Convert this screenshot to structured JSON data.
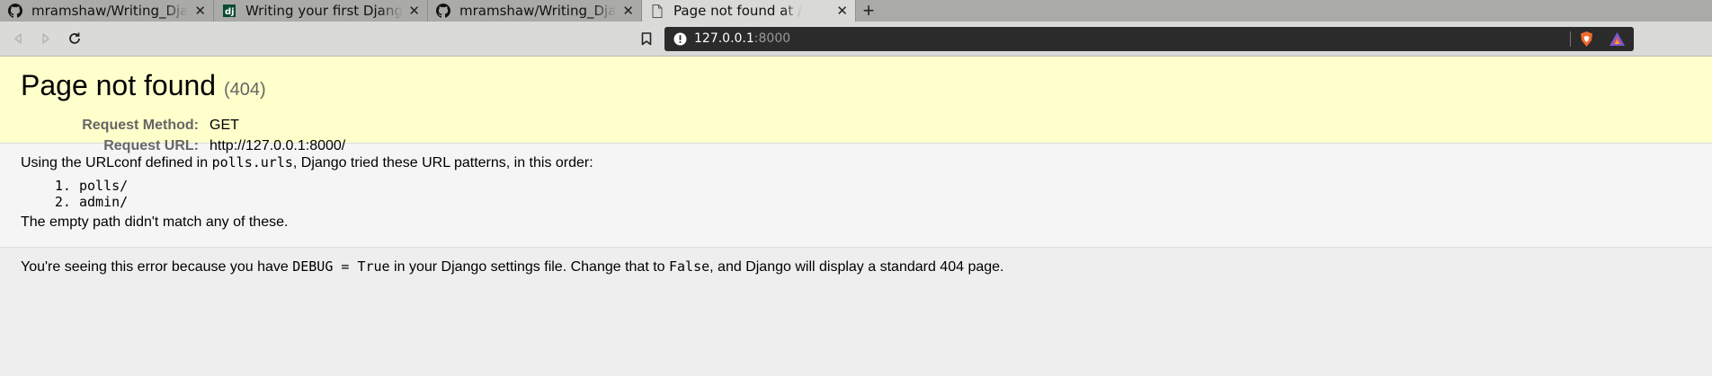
{
  "browser": {
    "tabs": [
      {
        "title": "mramshaw/Writing_Dja",
        "favicon": "github-icon",
        "active": false
      },
      {
        "title": "Writing your first Djang",
        "favicon": "django-icon",
        "active": false
      },
      {
        "title": "mramshaw/Writing_Dja",
        "favicon": "github-icon",
        "active": false
      },
      {
        "title": "Page not found at /",
        "favicon": "document-icon",
        "active": true
      }
    ],
    "close_glyph": "✕",
    "new_tab_glyph": "+",
    "url_host": "127.0.0.1",
    "url_port": ":8000"
  },
  "page": {
    "title": "Page not found",
    "status_code": "(404)",
    "request_method_label": "Request Method:",
    "request_method_value": "GET",
    "request_url_label": "Request URL:",
    "request_url_value": "http://127.0.0.1:8000/",
    "urlconf_text_before": "Using the URLconf defined in ",
    "urlconf_module": "polls.urls",
    "urlconf_text_after": ", Django tried these URL patterns, in this order:",
    "patterns": [
      "polls/",
      "admin/"
    ],
    "no_match_text": "The empty path didn't match any of these.",
    "explanation_before": "You're seeing this error because you have ",
    "debug_setting": "DEBUG = True",
    "explanation_middle": " in your Django settings file. Change that to ",
    "false_value": "False",
    "explanation_after": ", and Django will display a standard 404 page."
  }
}
